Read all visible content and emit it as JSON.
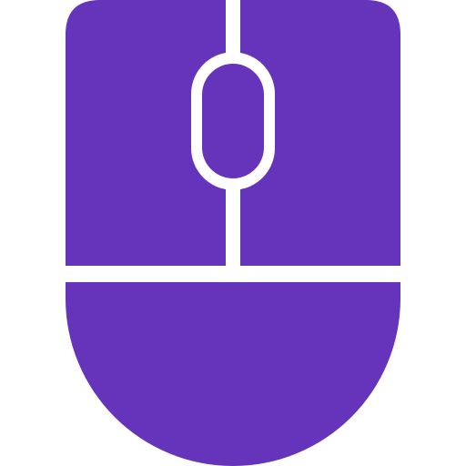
{
  "icon": {
    "name": "computer-mouse-icon",
    "fill_color": "#6633BB",
    "cutout_color": "#FFFFFF"
  }
}
